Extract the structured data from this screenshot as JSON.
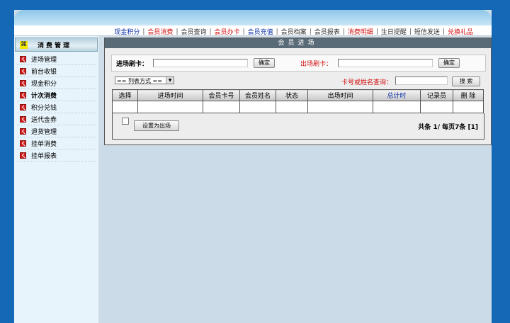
{
  "topnav": {
    "items": [
      {
        "label": "现金积分",
        "color": "#0a2ea8"
      },
      {
        "label": "会员消费",
        "color": "#d41010"
      },
      {
        "label": "会员查询",
        "color": "#333333"
      },
      {
        "label": "会员办卡",
        "color": "#d41010"
      },
      {
        "label": "会员充值",
        "color": "#0a2ea8"
      },
      {
        "label": "会员档案",
        "color": "#333333"
      },
      {
        "label": "会员报表",
        "color": "#333333"
      },
      {
        "label": "消费明细",
        "color": "#d41010"
      },
      {
        "label": "生日提醒",
        "color": "#333333"
      },
      {
        "label": "短信发送",
        "color": "#333333"
      },
      {
        "label": "兑换礼品",
        "color": "#d41010"
      }
    ]
  },
  "sidebar": {
    "title": "消费管理",
    "items": [
      {
        "label": "进场管理"
      },
      {
        "label": "前台收银"
      },
      {
        "label": "现金积分"
      },
      {
        "label": "计次消费"
      },
      {
        "label": "积分兑钱"
      },
      {
        "label": "送代金券"
      },
      {
        "label": "退货管理"
      },
      {
        "label": "挂单消费"
      },
      {
        "label": "挂单报表"
      }
    ]
  },
  "panel": {
    "title": "会员进场",
    "entry_label": "进场刷卡：",
    "entry_confirm": "确定",
    "exit_label": "出场刷卡：",
    "exit_confirm": "确定",
    "list_mode": "== 列表方式 ==",
    "search_label": "卡号或姓名查询：",
    "search_button": "搜 索",
    "columns": [
      "选择",
      "进场时间",
      "会员卡号",
      "会员姓名",
      "状态",
      "出场时间",
      "总计时",
      "记录员",
      "删 除"
    ],
    "set_exit_button": "设置为出场",
    "pagination": "共条 1/ 每页7条 [1]"
  },
  "colors": {
    "accent_red": "#d41010",
    "accent_blue": "#0a2ea8",
    "page_bg": "#1568b6"
  }
}
